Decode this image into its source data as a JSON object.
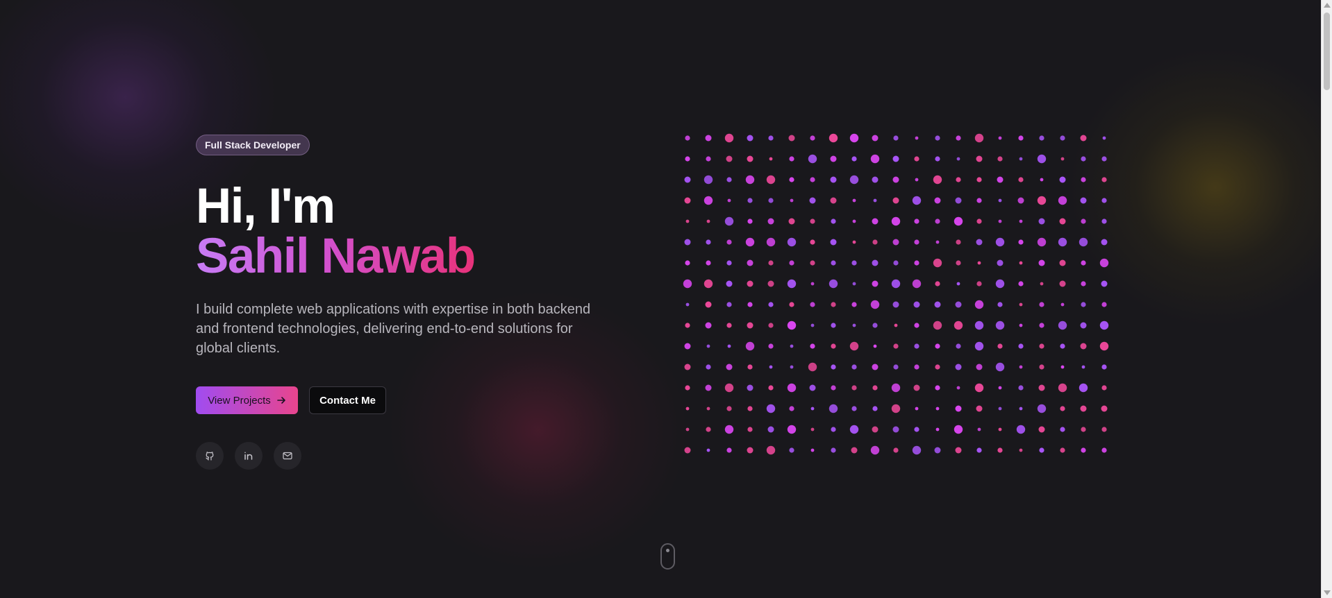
{
  "hero": {
    "badge": "Full Stack Developer",
    "greeting": "Hi, I'm",
    "name": "Sahil Nawab",
    "description": "I build complete web applications with expertise in both backend and frontend technologies, delivering end-to-end solutions for global clients.",
    "primary_button": "View Projects",
    "secondary_button": "Contact Me"
  },
  "socials": [
    {
      "icon": "github-icon"
    },
    {
      "icon": "linkedin-icon"
    },
    {
      "icon": "mail-icon"
    }
  ],
  "dot_grid": {
    "rows": 16,
    "columns": 21,
    "colors": [
      "#a855f7",
      "#d946ef",
      "#ec4899"
    ]
  },
  "colors": {
    "background": "#19181c",
    "accent_start": "#a855f7",
    "accent_end": "#ec4899"
  }
}
